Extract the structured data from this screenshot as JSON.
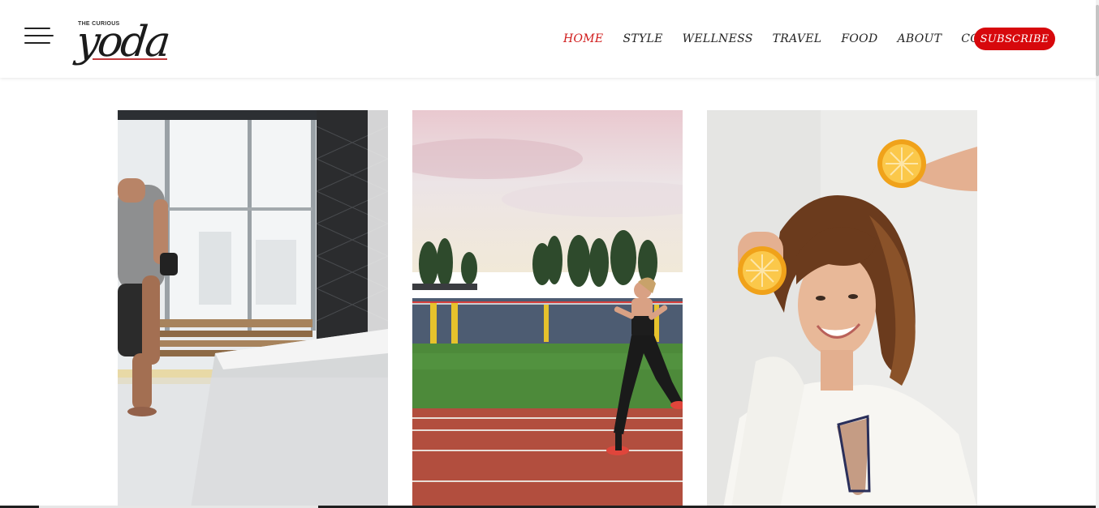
{
  "header": {
    "logo": {
      "small_text": "THE CURIOUS",
      "word": "yoda"
    },
    "nav": [
      {
        "label": "HOME",
        "active": true
      },
      {
        "label": "STYLE",
        "active": false
      },
      {
        "label": "WELLNESS",
        "active": false
      },
      {
        "label": "TRAVEL",
        "active": false
      },
      {
        "label": "FOOD",
        "active": false
      },
      {
        "label": "ABOUT",
        "active": false
      },
      {
        "label": "CONTACT",
        "active": false
      }
    ],
    "subscribe_label": "SUBSCRIBE",
    "menu_icon": "hamburger-menu-icon"
  },
  "colors": {
    "accent": "#d7080c",
    "active_nav": "#d01a1a",
    "text": "#222222"
  },
  "gallery": {
    "images": [
      {
        "subject": "man stretching leg in gym by window"
      },
      {
        "subject": "woman running on stadium track"
      },
      {
        "subject": "smiling woman holding orange halves"
      }
    ]
  }
}
